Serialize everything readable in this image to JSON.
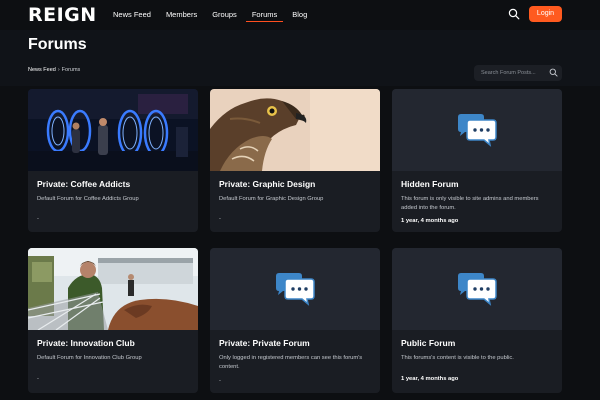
{
  "brand": {
    "logo_text": "REIGN",
    "accent": "#ff5a1f"
  },
  "nav": {
    "items": [
      {
        "label": "News Feed"
      },
      {
        "label": "Members"
      },
      {
        "label": "Groups"
      },
      {
        "label": "Forums",
        "active": true
      },
      {
        "label": "Blog"
      }
    ]
  },
  "header": {
    "login_label": "Login",
    "search_icon": "search-icon"
  },
  "page": {
    "title": "Forums",
    "breadcrumb": {
      "home": "News Feed",
      "separator": "›",
      "current": "Forums"
    },
    "search_placeholder": "Search Forum Posts..."
  },
  "forums": [
    {
      "title": "Private: Coffee Addicts",
      "description": "Default Forum for Coffee Addicts Group",
      "meta": "-",
      "media": "photo-coffee"
    },
    {
      "title": "Private: Graphic Design",
      "description": "Default Forum for Graphic Design Group",
      "meta": "-",
      "media": "photo-hawk"
    },
    {
      "title": "Hidden Forum",
      "description": "This forum is only visible to site admins and members added into the forum.",
      "meta": "1 year, 4 months ago",
      "media": "forum-bubbles-icon"
    },
    {
      "title": "Private: Innovation Club",
      "description": "Default Forum for Innovation Club Group",
      "meta": "-",
      "media": "photo-farm"
    },
    {
      "title": "Private: Private Forum",
      "description": "Only logged in registered members can see this forum's content.",
      "meta": "-",
      "media": "forum-bubbles-icon"
    },
    {
      "title": "Public Forum",
      "description": "This forums's content is visible to the public.",
      "meta": "1 year, 4 months ago",
      "media": "forum-bubbles-icon"
    }
  ]
}
